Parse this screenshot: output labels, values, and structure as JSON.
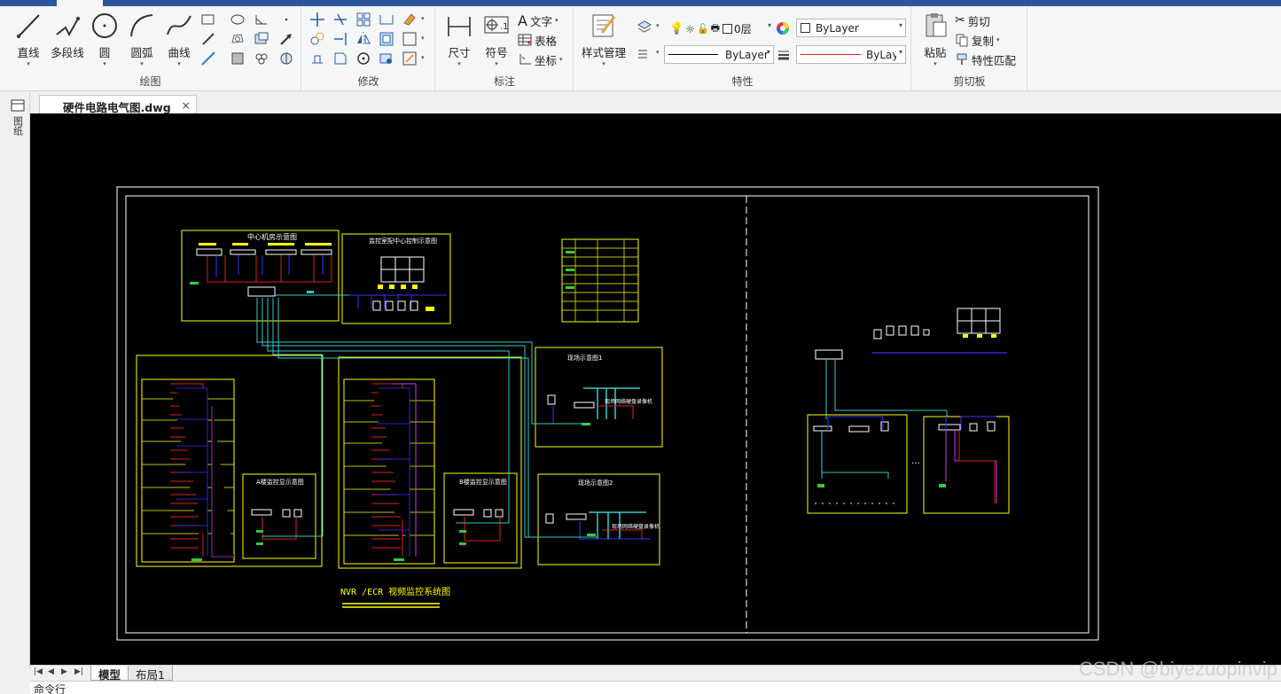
{
  "ribbon": {
    "groups": {
      "draw": "绘图",
      "modify": "修改",
      "annotate": "标注",
      "properties": "特性",
      "clipboard": "剪切板"
    },
    "draw": {
      "line": "直线",
      "polyline": "多段线",
      "circle": "圆",
      "arc": "圆弧",
      "curve": "曲线"
    },
    "annotate": {
      "dimension": "尺寸",
      "symbol": "符号",
      "text": "文字",
      "table": "表格",
      "coordinate": "坐标"
    },
    "properties": {
      "style_manager": "样式管理",
      "layer": "0层",
      "color": "ByLayer",
      "linetype": "ByLayer",
      "lineweight": "ByLaye"
    },
    "clipboard": {
      "paste": "粘贴",
      "cut": "剪切",
      "copy": "复制",
      "match": "特性匹配"
    },
    "colors": {
      "accent": "#2b579a"
    }
  },
  "file_tab": {
    "name": "硬件电路电气图.dwg",
    "close": "×"
  },
  "left_dock": {
    "label": "图纸"
  },
  "drawing": {
    "title": "NVR /ECR 视频监控系统图",
    "blocks": {
      "center": "中心机房示意图",
      "monitor": "监控室配中心控制示意图",
      "a_monitor": "A楼监控显示意图",
      "b_monitor": "B楼监控显示意图",
      "site1": "现场示意图1",
      "site2": "现场示意图2",
      "site1_note": "现场网络硬盘录像机",
      "site2_note": "现场网络硬盘录像机"
    },
    "colors": {
      "frame": "#ffffff",
      "block": "#ffff00",
      "bus": "#3333ff",
      "link": "#33cccc",
      "wire": "#ff2222",
      "device": "#ffffff"
    }
  },
  "layout_tabs": [
    "模型",
    "布局1"
  ],
  "command_line": "命令行",
  "watermark": "CSDN @biyezuopinvip"
}
